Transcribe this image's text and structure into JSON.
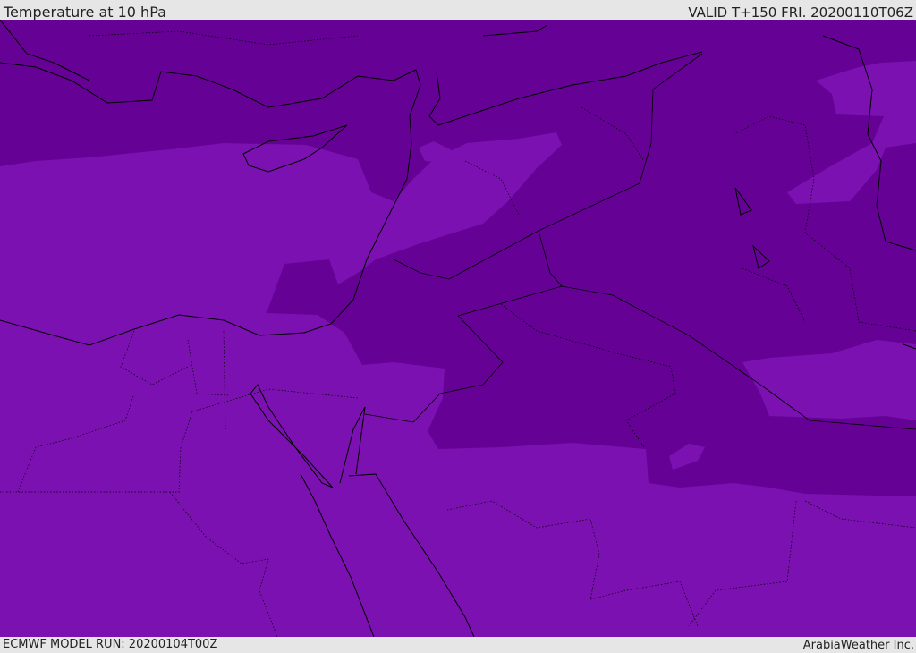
{
  "header": {
    "title": "Temperature at 10 hPa",
    "valid": "VALID T+150 FRI. 20200110T06Z"
  },
  "footer": {
    "model_run": "ECMWF MODEL RUN: 20200104T00Z",
    "credit": "ArabiaWeather Inc."
  },
  "colors": {
    "cold": "#650295",
    "cool": "#7b11b1",
    "border": "#000000",
    "frame": "#e6e6e6"
  }
}
